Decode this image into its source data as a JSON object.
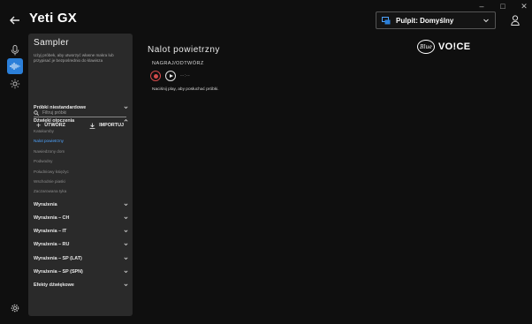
{
  "window": {
    "controls": [
      "–",
      "□",
      "✕"
    ]
  },
  "header": {
    "app_title": "Yeti GX",
    "profile_label": "Pulpit: Domyślny"
  },
  "logo": {
    "brand": "Blue",
    "product": "VO!CE"
  },
  "rail": {
    "items": [
      "microphone-icon",
      "waveform-icon",
      "lighting-icon"
    ],
    "active": 1
  },
  "sampler": {
    "title": "Sampler",
    "description": "Użyj próbek, aby utworzyć własne makra lub przypisać je bezpośrednio do klawisza",
    "filter_placeholder": "Filtruj próbki",
    "create_label": "UTWÓRZ",
    "import_label": "IMPORTUJ",
    "categories": [
      {
        "label": "Próbki niestandardowe",
        "expanded": false
      },
      {
        "label": "Dźwięki otoczenia",
        "expanded": true,
        "items": [
          "Katakumby",
          "Nalot powietrzny",
          "Nawiedzony dom",
          "Podwodny",
          "Południowy księżyc",
          "Wschodnie piaski",
          "Zaczarowana tyka"
        ],
        "selected": 1
      },
      {
        "label": "Wyrażenia",
        "expanded": false
      },
      {
        "label": "Wyrażenia – CH",
        "expanded": false
      },
      {
        "label": "Wyrażenia – IT",
        "expanded": false
      },
      {
        "label": "Wyrażenia – RU",
        "expanded": false
      },
      {
        "label": "Wyrażenia – SP (LAT)",
        "expanded": false
      },
      {
        "label": "Wyrażenia – SP (SPN)",
        "expanded": false
      },
      {
        "label": "Efekty dźwiękowe",
        "expanded": false
      }
    ]
  },
  "detail": {
    "title": "Nalot powietrzny",
    "record_label": "NAGRAJ/ODTWÓRZ",
    "time": "--:--",
    "hint": "Naciśnij play, aby posłuchać próbki."
  },
  "colors": {
    "accent": "#2b7fd9",
    "selected": "#4ea4ff",
    "record": "#d24a4a",
    "panel": "#2a2a2a"
  }
}
